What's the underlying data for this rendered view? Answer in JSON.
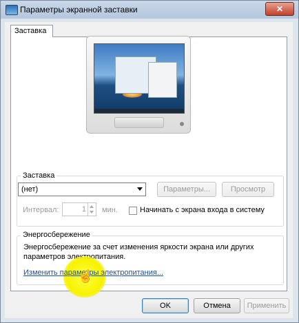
{
  "window": {
    "title": "Параметры экранной заставки",
    "close_glyph": "✕",
    "tab": "Заставка"
  },
  "screensaver": {
    "group_label": "Заставка",
    "selected": "(нет)",
    "settings_button": "Параметры...",
    "preview_button": "Просмотр",
    "interval_label": "Интервал:",
    "interval_value": "1",
    "minutes_label": "мин.",
    "logon_checkbox_label": "Начинать с экрана входа в систему",
    "logon_checked": false
  },
  "power": {
    "group_label": "Энергосбережение",
    "description": "Энергосбережение за счет изменения яркости экрана или других параметров электропитания.",
    "link": "Изменить параметры электропитания..."
  },
  "buttons": {
    "ok": "OK",
    "cancel": "Отмена",
    "apply": "Применить"
  },
  "colors": {
    "link": "#1c4fa8",
    "highlight": "#f7f200"
  },
  "icons": [
    "monitor-preview-icon",
    "dropdown-arrow-icon",
    "hand-cursor-icon"
  ]
}
